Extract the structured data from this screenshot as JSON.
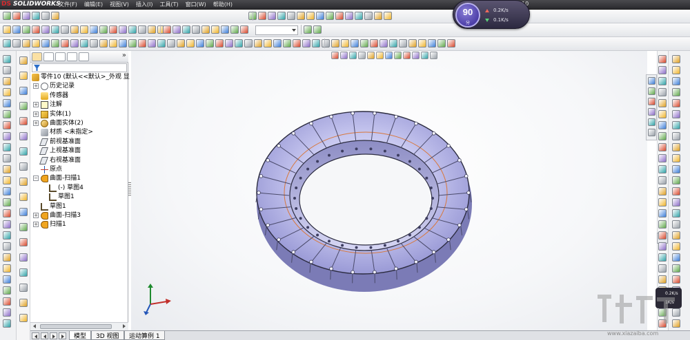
{
  "app": {
    "logo_text": "SOLIDWORKS",
    "logo_prefix": "DS",
    "document_title": "零件10"
  },
  "menu": {
    "items": [
      "文件(F)",
      "编辑(E)",
      "视图(V)",
      "插入(I)",
      "工具(T)",
      "窗口(W)",
      "帮助(H)"
    ]
  },
  "toolbar": {
    "dropdown_value": ""
  },
  "feature_manager": {
    "tree": [
      {
        "label": "零件10  (默认<<默认>_外观 显",
        "icon": "part-icon",
        "expander": "",
        "indent": 0
      },
      {
        "label": "历史记录",
        "icon": "history-icon",
        "expander": "+",
        "indent": 1
      },
      {
        "label": "传感器",
        "icon": "sensor-icon",
        "expander": "",
        "indent": 1
      },
      {
        "label": "注解",
        "icon": "annotation-icon",
        "expander": "+",
        "indent": 1
      },
      {
        "label": "实体(1)",
        "icon": "solid-bodies-icon",
        "expander": "+",
        "indent": 1
      },
      {
        "label": "曲面实体(2)",
        "icon": "surface-bodies-icon",
        "expander": "+",
        "indent": 1
      },
      {
        "label": "材质 <未指定>",
        "icon": "material-icon",
        "expander": "",
        "indent": 1
      },
      {
        "label": "前视基准面",
        "icon": "plane-icon",
        "expander": "",
        "indent": 1
      },
      {
        "label": "上视基准面",
        "icon": "plane-icon",
        "expander": "",
        "indent": 1
      },
      {
        "label": "右视基准面",
        "icon": "plane-icon",
        "expander": "",
        "indent": 1
      },
      {
        "label": "原点",
        "icon": "origin-icon",
        "expander": "",
        "indent": 1
      },
      {
        "label": "曲面-扫描1",
        "icon": "sweep-icon",
        "expander": "−",
        "indent": 1
      },
      {
        "label": "(-) 草图4",
        "icon": "sketch-icon",
        "expander": "",
        "indent": 2
      },
      {
        "label": "草图1",
        "icon": "sketch-icon",
        "expander": "",
        "indent": 2
      },
      {
        "label": "草图1",
        "icon": "sketch-icon",
        "expander": "",
        "indent": 1
      },
      {
        "label": "曲面-扫描3",
        "icon": "sweep-icon",
        "expander": "+",
        "indent": 1
      },
      {
        "label": "扫描1",
        "icon": "sweep-icon",
        "expander": "+",
        "indent": 1
      }
    ],
    "collapse_symbol": "»"
  },
  "bottom_tabs": [
    "模型",
    "3D 视图",
    "运动算例 1"
  ],
  "net_widget": {
    "score": "90",
    "score_unit": "分",
    "upload": "0.2K/s",
    "download": "0.1K/s",
    "mini_upload": "0.2K/s",
    "mini_download": "1K/s"
  },
  "watermark": {
    "url": "www.xiazaiba.com"
  },
  "colors": {
    "torus_body": "#c8c8f0",
    "torus_shadow": "#8e8ec8",
    "torus_edge": "#2c2c40",
    "inner_curve": "#d9773a",
    "accent": "#f0a51f"
  }
}
